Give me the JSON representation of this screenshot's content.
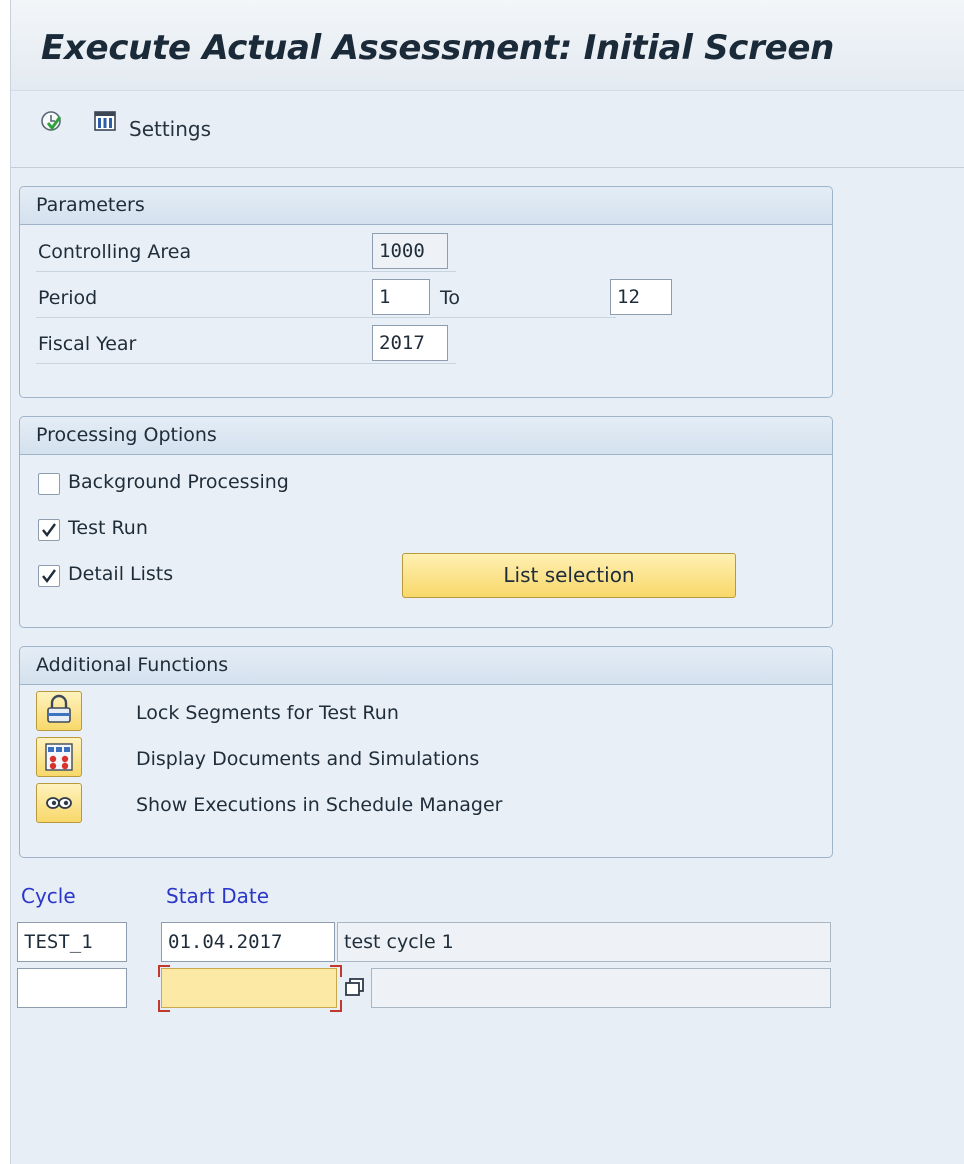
{
  "title": "Execute Actual Assessment: Initial Screen",
  "toolbar": {
    "execute_icon": "execute-icon",
    "settings_icon": "layout-settings-icon",
    "settings_label": "Settings"
  },
  "parameters": {
    "heading": "Parameters",
    "controlling_area_label": "Controlling Area",
    "controlling_area_value": "1000",
    "period_label": "Period",
    "period_from": "1",
    "period_to_label": "To",
    "period_to": "12",
    "fiscal_year_label": "Fiscal Year",
    "fiscal_year_value": "2017"
  },
  "processing_options": {
    "heading": "Processing Options",
    "background_label": "Background Processing",
    "background_checked": false,
    "test_run_label": "Test Run",
    "test_run_checked": true,
    "detail_lists_label": "Detail Lists",
    "detail_lists_checked": true,
    "list_selection_label": "List selection"
  },
  "additional_functions": {
    "heading": "Additional Functions",
    "items": [
      {
        "icon": "lock-icon",
        "label": "Lock Segments for Test Run"
      },
      {
        "icon": "documents-simulation-icon",
        "label": "Display Documents and Simulations"
      },
      {
        "icon": "glasses-icon",
        "label": "Show Executions in Schedule Manager"
      }
    ]
  },
  "cycle_table": {
    "col_cycle": "Cycle",
    "col_start_date": "Start Date",
    "rows": [
      {
        "cycle": "TEST_1",
        "start_date": "01.04.2017",
        "description": "test cycle 1"
      },
      {
        "cycle": "",
        "start_date": "",
        "description": ""
      }
    ]
  },
  "colors": {
    "accent_yellow": "#f8d86a",
    "header_blue": "#2a37c8",
    "background": "#e8eef5"
  }
}
